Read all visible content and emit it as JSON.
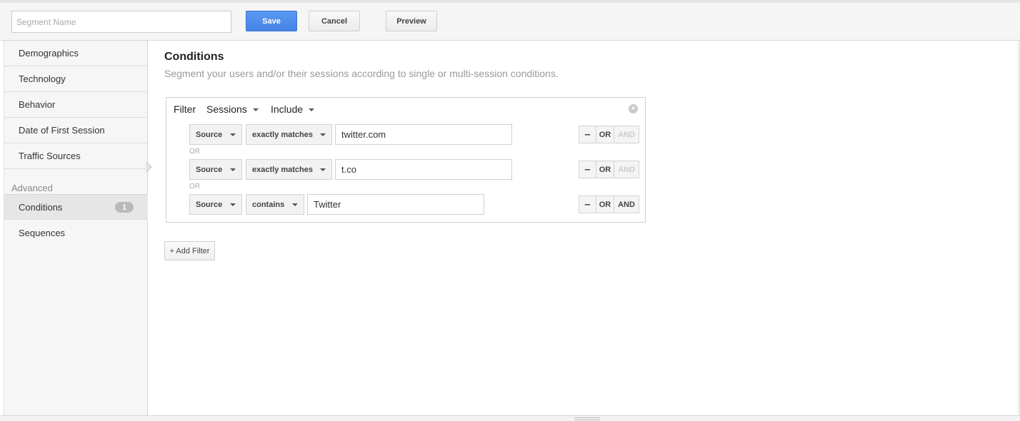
{
  "toolbar": {
    "segment_name_placeholder": "Segment Name",
    "save_label": "Save",
    "cancel_label": "Cancel",
    "preview_label": "Preview"
  },
  "sidebar": {
    "items": [
      {
        "label": "Demographics"
      },
      {
        "label": "Technology"
      },
      {
        "label": "Behavior"
      },
      {
        "label": "Date of First Session"
      },
      {
        "label": "Traffic Sources"
      }
    ],
    "advanced_heading": "Advanced",
    "advanced_items": [
      {
        "label": "Conditions",
        "badge": "1",
        "active": true
      },
      {
        "label": "Sequences"
      }
    ]
  },
  "main": {
    "title": "Conditions",
    "subtitle": "Segment your users and/or their sessions according to single or multi-session conditions.",
    "filter": {
      "label": "Filter",
      "scope": "Sessions",
      "mode": "Include",
      "rows": [
        {
          "dimension": "Source",
          "operator": "exactly matches",
          "value": "twitter.com",
          "minus": "–",
          "or": "OR",
          "and": "AND",
          "and_enabled": false
        },
        {
          "dimension": "Source",
          "operator": "exactly matches",
          "value": "t.co",
          "minus": "–",
          "or": "OR",
          "and": "AND",
          "and_enabled": false
        },
        {
          "dimension": "Source",
          "operator": "contains",
          "value": "Twitter",
          "minus": "–",
          "or": "OR",
          "and": "AND",
          "and_enabled": true
        }
      ],
      "separators": [
        "OR",
        "OR"
      ]
    },
    "add_filter_label": "+ Add Filter"
  },
  "colors": {
    "save_button": "#4a8af4",
    "sidebar_bg": "#f6f6f6",
    "active_item_bg": "#e6e6e6"
  }
}
